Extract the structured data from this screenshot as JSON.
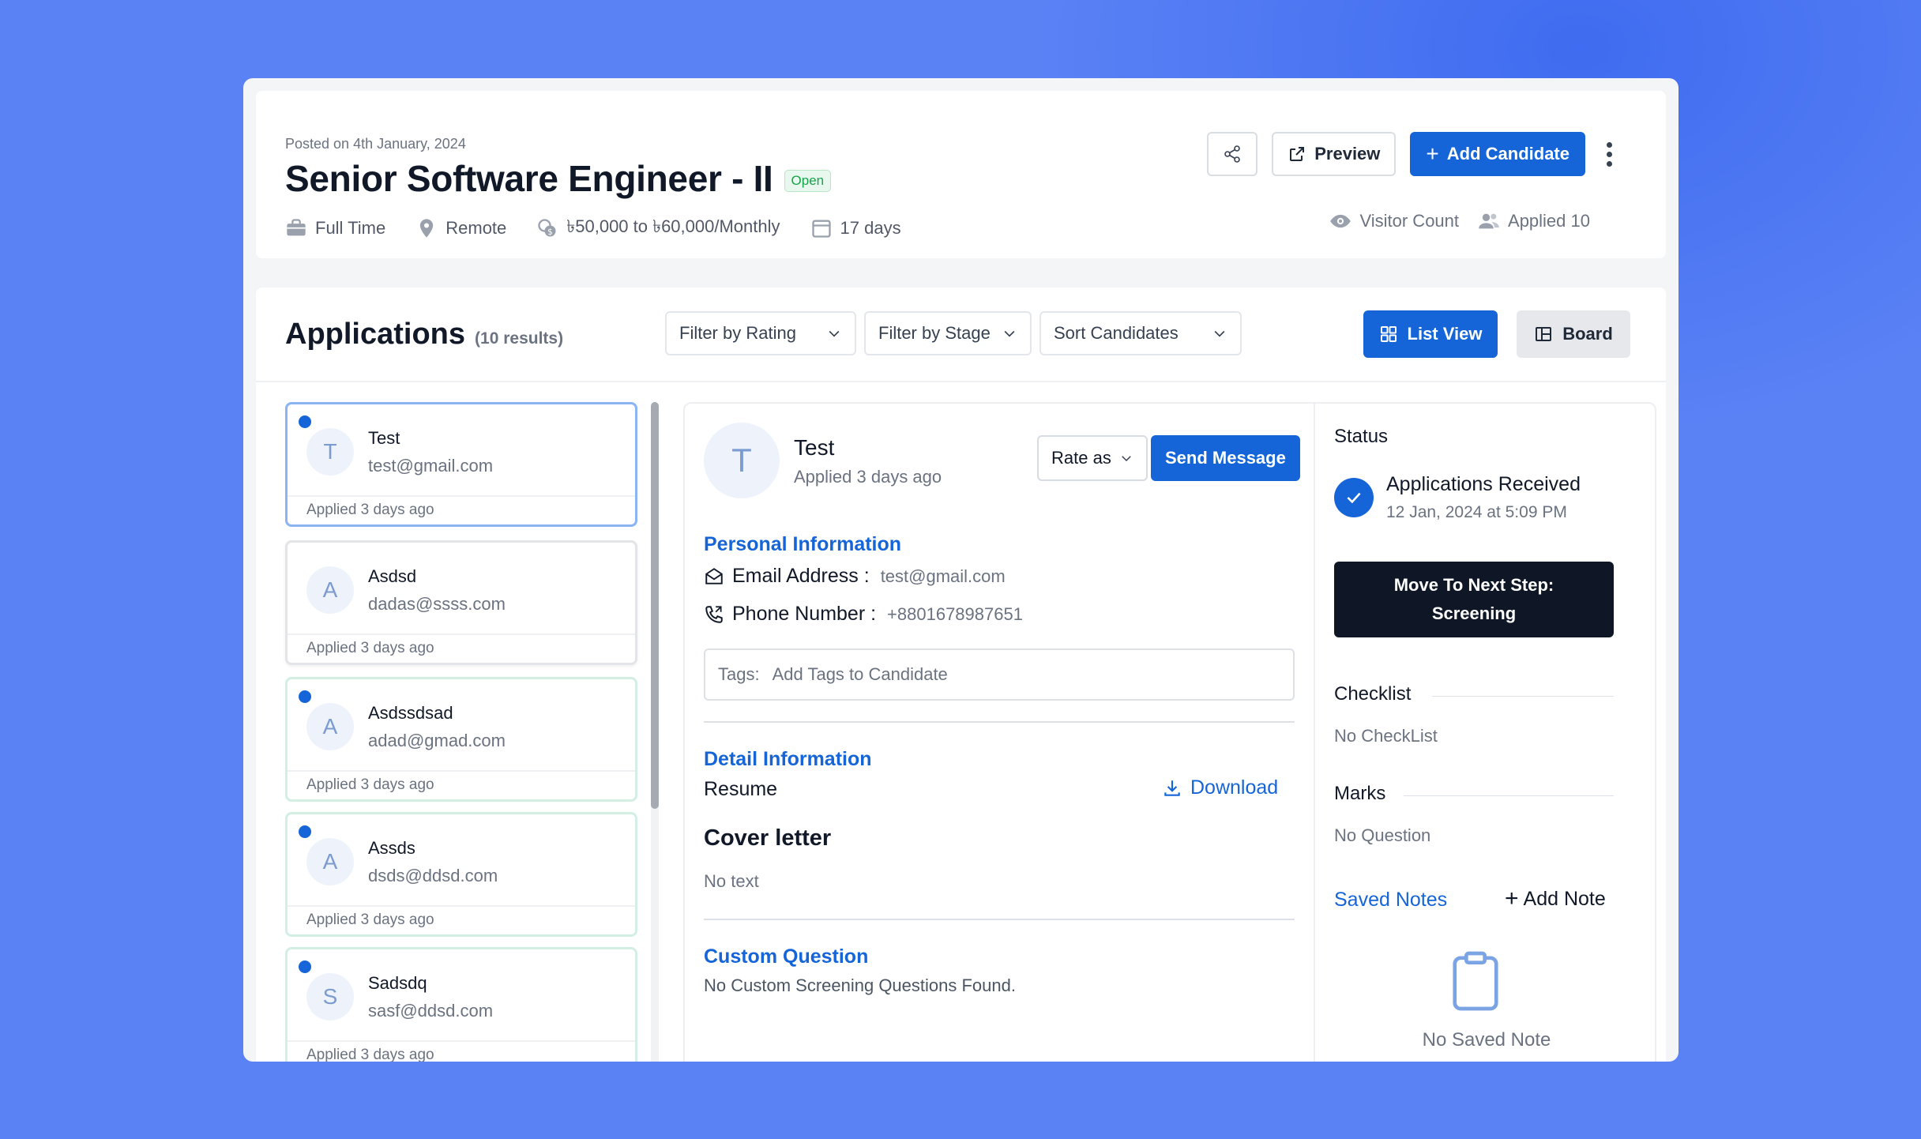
{
  "job": {
    "posted": "Posted on 4th January, 2024",
    "title": "Senior Software Engineer - II",
    "status": "Open",
    "type": "Full Time",
    "location": "Remote",
    "salary": "৳50,000 to ৳60,000/Monthly",
    "duration": "17 days",
    "preview_label": "Preview",
    "add_candidate_label": "Add Candidate",
    "visitor_label": "Visitor Count",
    "applied_label": "Applied 10"
  },
  "applications": {
    "title": "Applications",
    "count": "(10 results)",
    "filter_rating": "Filter by Rating",
    "filter_stage": "Filter by Stage",
    "sort": "Sort Candidates",
    "list_view": "List View",
    "board_view": "Board"
  },
  "candidates": [
    {
      "initial": "T",
      "name": "Test",
      "email": "test@gmail.com",
      "applied": "Applied 3 days ago",
      "unread": true
    },
    {
      "initial": "A",
      "name": "Asdsd",
      "email": "dadas@ssss.com",
      "applied": "Applied 3 days ago",
      "unread": false
    },
    {
      "initial": "A",
      "name": "Asdssdsad",
      "email": "adad@gmad.com",
      "applied": "Applied 3 days ago",
      "unread": true
    },
    {
      "initial": "A",
      "name": "Assds",
      "email": "dsds@ddsd.com",
      "applied": "Applied 3 days ago",
      "unread": true
    },
    {
      "initial": "S",
      "name": "Sadsdq",
      "email": "sasf@ddsd.com",
      "applied": "Applied 3 days ago",
      "unread": true
    }
  ],
  "detail": {
    "initial": "T",
    "name": "Test",
    "applied": "Applied 3 days ago",
    "rate_label": "Rate as",
    "send_label": "Send Message",
    "personal_title": "Personal Information",
    "email_label": "Email Address :",
    "email_value": "test@gmail.com",
    "phone_label": "Phone Number :",
    "phone_value": "+8801678987651",
    "tags_label": "Tags:",
    "tags_placeholder": "Add Tags to Candidate",
    "detail_title": "Detail Information",
    "resume_label": "Resume",
    "download_label": "Download",
    "cover_title": "Cover letter",
    "cover_text": "No text",
    "custom_title": "Custom Question",
    "custom_text": "No Custom Screening Questions Found."
  },
  "sidebar": {
    "status_label": "Status",
    "stage_name": "Applications Received",
    "stage_time": "12 Jan, 2024 at 5:09 PM",
    "next_line1": "Move To Next Step:",
    "next_line2": "Screening",
    "checklist_label": "Checklist",
    "checklist_empty": "No CheckList",
    "marks_label": "Marks",
    "marks_empty": "No Question",
    "notes_label": "Saved Notes",
    "add_note_label": "Add Note",
    "notes_empty": "No Saved Note"
  }
}
